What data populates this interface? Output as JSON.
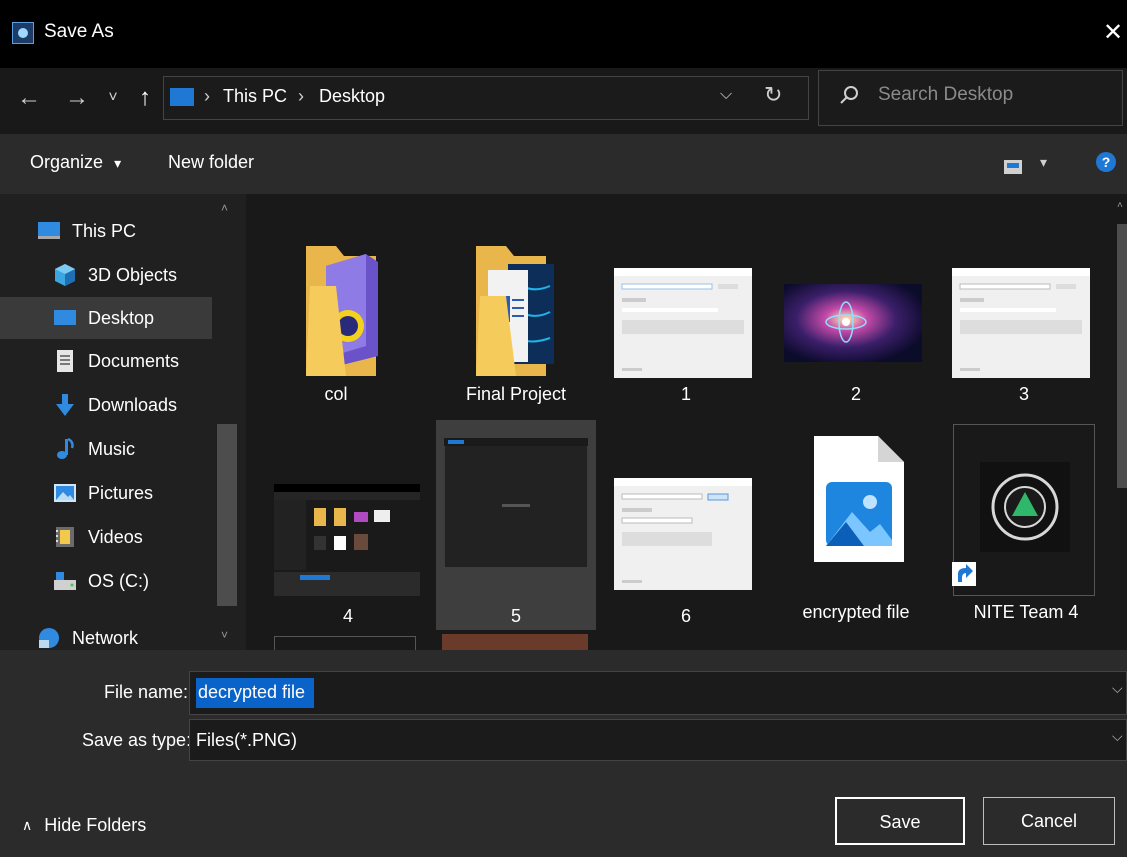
{
  "window": {
    "title": "Save As",
    "close_glyph": "✕",
    "icon": "app-icon"
  },
  "nav": {
    "back_glyph": "←",
    "forward_glyph": "→",
    "recent_glyph": "˅",
    "up_glyph": "↑",
    "refresh_glyph": "↻",
    "dropdown_glyph": "⌵"
  },
  "address": {
    "separator": "›",
    "breadcrumbs": [
      "This PC",
      "Desktop"
    ],
    "root_icon": "pc-icon"
  },
  "search": {
    "placeholder": "Search Desktop"
  },
  "toolbar": {
    "organize_label": "Organize",
    "organize_glyph": "▾",
    "new_folder_label": "New folder",
    "view_glyph": "▾",
    "help_glyph": "?"
  },
  "sidebar": {
    "items": [
      {
        "label": "This PC",
        "icon": "pc-icon"
      },
      {
        "label": "3D Objects",
        "icon": "cube-icon"
      },
      {
        "label": "Desktop",
        "icon": "desktop-icon",
        "selected": true
      },
      {
        "label": "Documents",
        "icon": "document-icon"
      },
      {
        "label": "Downloads",
        "icon": "download-icon"
      },
      {
        "label": "Music",
        "icon": "music-icon"
      },
      {
        "label": "Pictures",
        "icon": "picture-icon"
      },
      {
        "label": "Videos",
        "icon": "video-icon"
      },
      {
        "label": "OS (C:)",
        "icon": "drive-icon"
      },
      {
        "label": "Network",
        "icon": "network-icon"
      }
    ],
    "scroll_up_glyph": "˄",
    "scroll_down_glyph": "˅"
  },
  "files": [
    {
      "name": "col",
      "type": "folder"
    },
    {
      "name": "Final Project",
      "type": "folder"
    },
    {
      "name": "1",
      "type": "image"
    },
    {
      "name": "2",
      "type": "image"
    },
    {
      "name": "3",
      "type": "image"
    },
    {
      "name": "4",
      "type": "image"
    },
    {
      "name": "5",
      "type": "image",
      "selected": true
    },
    {
      "name": "6",
      "type": "image"
    },
    {
      "name": "encrypted file",
      "type": "file"
    },
    {
      "name": "NITE Team 4",
      "type": "shortcut"
    }
  ],
  "form": {
    "file_name_label": "File name:",
    "file_name_value": "decrypted file",
    "save_type_label": "Save as type:",
    "save_type_value": "Files(*.PNG)",
    "dropdown_glyph": "⌵"
  },
  "footer": {
    "hide_folders_label": "Hide Folders",
    "hide_folders_glyph": "∧",
    "save_label": "Save",
    "cancel_label": "Cancel"
  },
  "colors": {
    "accent": "#1e78d4",
    "selection": "#0a63c9",
    "background": "#202020"
  }
}
